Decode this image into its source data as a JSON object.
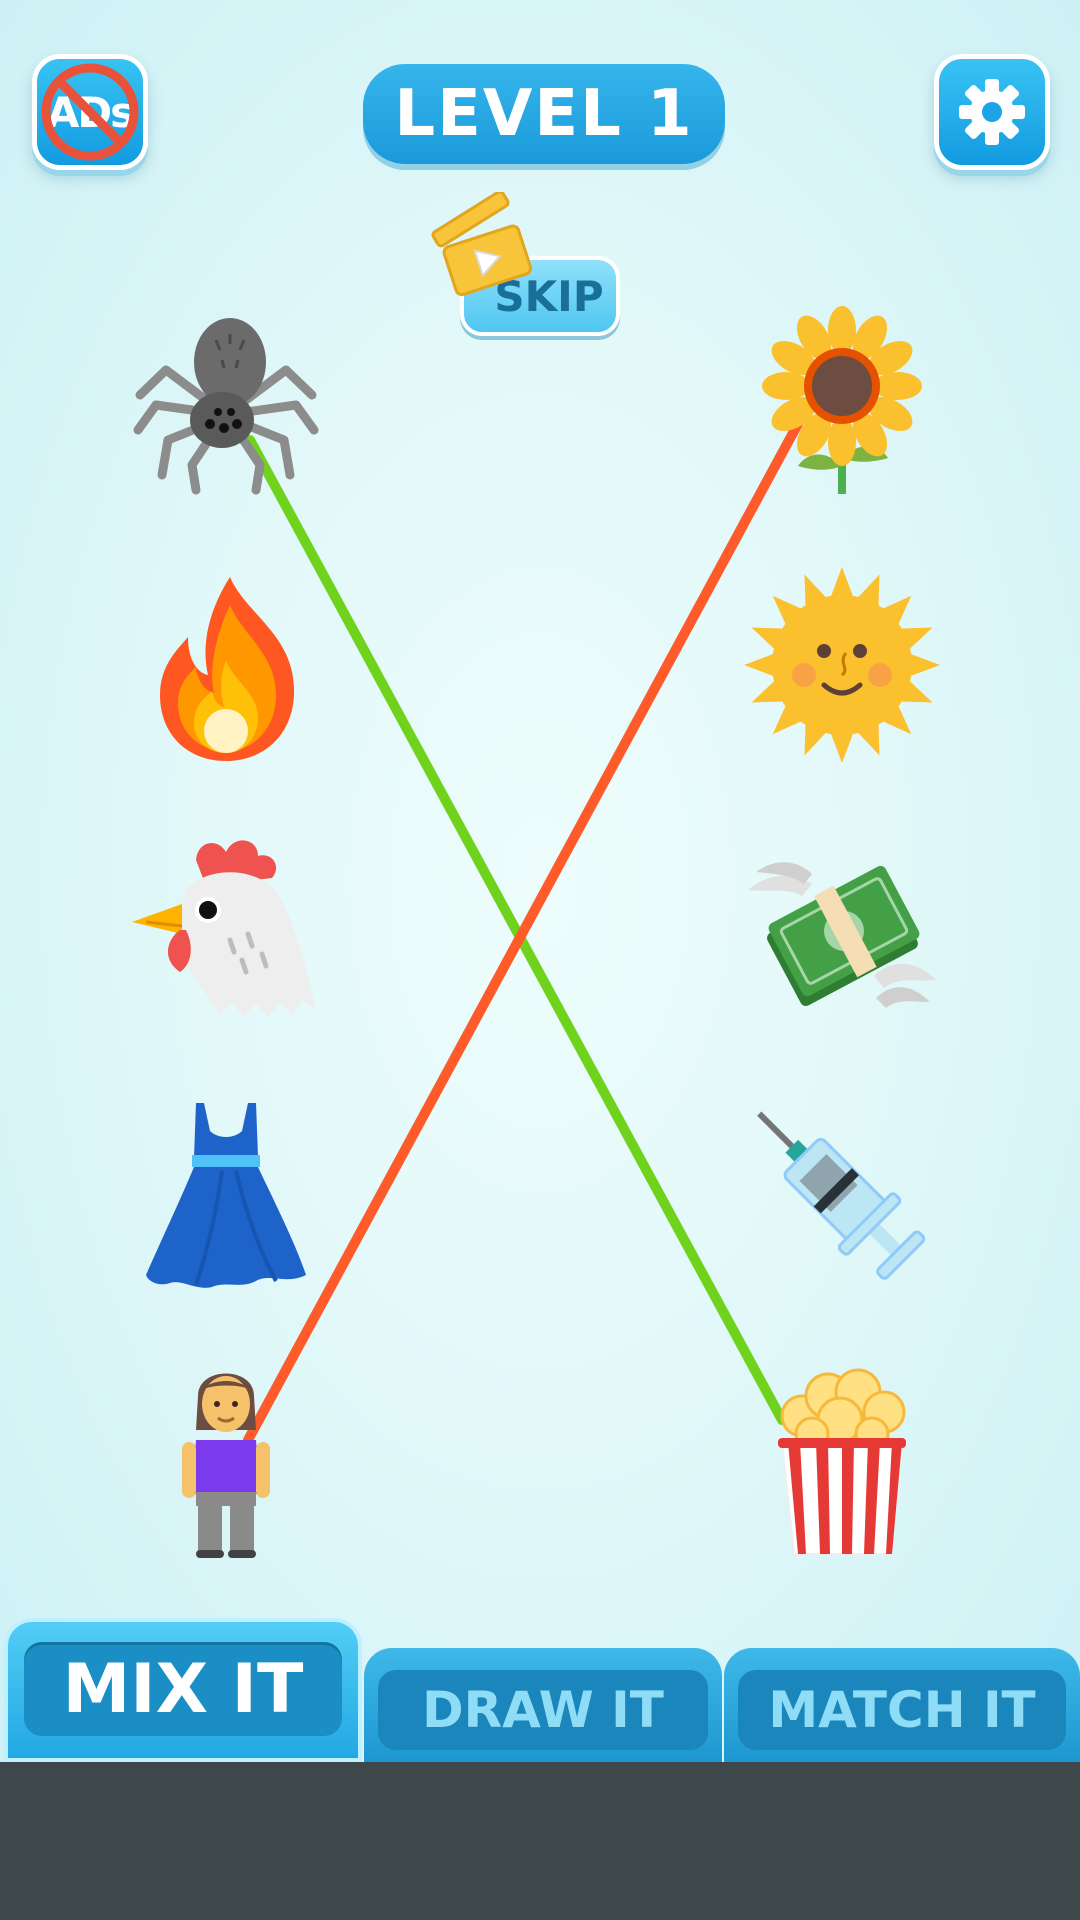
{
  "header": {
    "no_ads_label": "ADs",
    "level_title": "LEVEL 1",
    "settings_icon": "gear-icon"
  },
  "skip": {
    "label": "SKIP",
    "icon": "clapperboard-play-icon"
  },
  "left_column": [
    "spider",
    "fire",
    "chicken",
    "dress",
    "woman"
  ],
  "right_column": [
    "sunflower",
    "sun-with-face",
    "money-with-wings",
    "syringe",
    "popcorn"
  ],
  "connections": [
    {
      "from": "spider",
      "to": "popcorn",
      "color": "#6fd21c"
    },
    {
      "from": "woman",
      "to": "sunflower",
      "color": "#ff5a2a"
    }
  ],
  "tabs": [
    {
      "label": "MIX IT",
      "active": true
    },
    {
      "label": "DRAW IT",
      "active": false
    },
    {
      "label": "MATCH IT",
      "active": false
    }
  ],
  "colors": {
    "accent": "#1a9ad9",
    "background": "#e2f8f9",
    "bottom_bar": "#3e4749"
  }
}
